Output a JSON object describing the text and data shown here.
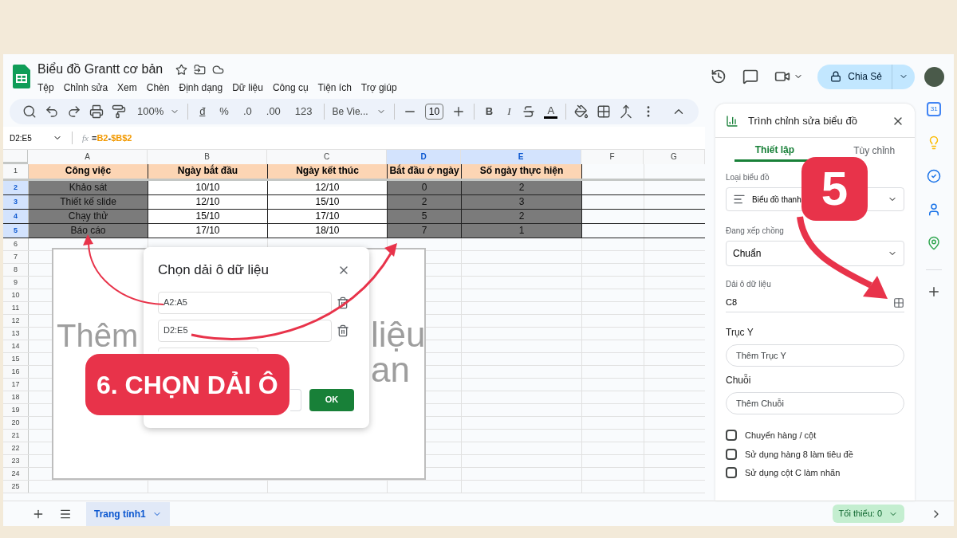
{
  "document": {
    "title": "Biểu đồ Grantt cơ bản"
  },
  "menu": [
    "Tệp",
    "Chỉnh sửa",
    "Xem",
    "Chèn",
    "Định dạng",
    "Dữ liệu",
    "Công cụ",
    "Tiện ích",
    "Trợ giúp"
  ],
  "share_button": {
    "label": "Chia Sẻ"
  },
  "toolbar": {
    "zoom": "100%",
    "currency": "đ",
    "percent": "%",
    "decrease_decimal": ".0",
    "increase_decimal": ".00",
    "number_format": "123",
    "font": "Be Vie...",
    "font_size": "10",
    "bold": "B",
    "italic": "I",
    "text_color": "A"
  },
  "formula_bar": {
    "name_box": "D2:E5",
    "fx": "fx",
    "tokens": [
      {
        "text": "=",
        "kind": "operator"
      },
      {
        "text": "B2",
        "kind": "reference"
      },
      {
        "text": "-",
        "kind": "operator"
      },
      {
        "text": "$B$2",
        "kind": "reference"
      }
    ]
  },
  "columns": [
    {
      "letter": "A",
      "selected": false
    },
    {
      "letter": "B",
      "selected": false
    },
    {
      "letter": "C",
      "selected": false
    },
    {
      "letter": "D",
      "selected": true
    },
    {
      "letter": "E",
      "selected": true
    },
    {
      "letter": "F",
      "selected": false
    },
    {
      "letter": "G",
      "selected": false
    }
  ],
  "rows": [
    {
      "number": "1",
      "selected": false,
      "kind": "header",
      "cells": [
        {
          "text": "Công việc",
          "highlighted": false
        },
        {
          "text": "Ngày bắt đầu",
          "highlighted": false
        },
        {
          "text": "Ngày kết thúc",
          "highlighted": false
        },
        {
          "text": "Bắt đầu ở ngày",
          "highlighted": false
        },
        {
          "text": "Số ngày thực hiện",
          "highlighted": false
        }
      ]
    },
    {
      "number": "2",
      "selected": true,
      "kind": "data",
      "cells": [
        {
          "text": "Khảo sát",
          "highlighted": true
        },
        {
          "text": "10/10",
          "highlighted": false
        },
        {
          "text": "12/10",
          "highlighted": false
        },
        {
          "text": "0",
          "highlighted": true
        },
        {
          "text": "2",
          "highlighted": true
        }
      ]
    },
    {
      "number": "3",
      "selected": true,
      "kind": "data",
      "cells": [
        {
          "text": "Thiết kế slide",
          "highlighted": true
        },
        {
          "text": "12/10",
          "highlighted": false
        },
        {
          "text": "15/10",
          "highlighted": false
        },
        {
          "text": "2",
          "highlighted": true
        },
        {
          "text": "3",
          "highlighted": true
        }
      ]
    },
    {
      "number": "4",
      "selected": true,
      "kind": "data",
      "cells": [
        {
          "text": "Chạy thử",
          "highlighted": true
        },
        {
          "text": "15/10",
          "highlighted": false
        },
        {
          "text": "17/10",
          "highlighted": false
        },
        {
          "text": "5",
          "highlighted": true
        },
        {
          "text": "2",
          "highlighted": true
        }
      ]
    },
    {
      "number": "5",
      "selected": true,
      "kind": "data",
      "cells": [
        {
          "text": "Báo cáo",
          "highlighted": true
        },
        {
          "text": "17/10",
          "highlighted": false
        },
        {
          "text": "18/10",
          "highlighted": false
        },
        {
          "text": "7",
          "highlighted": true
        },
        {
          "text": "1",
          "highlighted": true
        }
      ]
    },
    {
      "number": "6",
      "selected": false,
      "kind": "empty"
    },
    {
      "number": "7",
      "selected": false,
      "kind": "empty"
    },
    {
      "number": "8",
      "selected": false,
      "kind": "empty"
    },
    {
      "number": "9",
      "selected": false,
      "kind": "empty"
    },
    {
      "number": "10",
      "selected": false,
      "kind": "empty"
    },
    {
      "number": "11",
      "selected": false,
      "kind": "empty"
    },
    {
      "number": "12",
      "selected": false,
      "kind": "empty"
    },
    {
      "number": "13",
      "selected": false,
      "kind": "empty"
    },
    {
      "number": "14",
      "selected": false,
      "kind": "empty"
    },
    {
      "number": "15",
      "selected": false,
      "kind": "empty"
    },
    {
      "number": "16",
      "selected": false,
      "kind": "empty"
    },
    {
      "number": "17",
      "selected": false,
      "kind": "empty"
    },
    {
      "number": "18",
      "selected": false,
      "kind": "empty"
    },
    {
      "number": "19",
      "selected": false,
      "kind": "empty"
    },
    {
      "number": "20",
      "selected": false,
      "kind": "empty"
    },
    {
      "number": "21",
      "selected": false,
      "kind": "empty"
    },
    {
      "number": "22",
      "selected": false,
      "kind": "empty"
    },
    {
      "number": "23",
      "selected": false,
      "kind": "empty"
    },
    {
      "number": "24",
      "selected": false,
      "kind": "empty"
    },
    {
      "number": "25",
      "selected": false,
      "kind": "empty"
    }
  ],
  "chart_placeholder": {
    "fragments": [
      "Thêm",
      "liệu",
      "an"
    ]
  },
  "dialog": {
    "title": "Chọn dải ô dữ liệu",
    "ranges": [
      "A2:A5",
      "D2:E5"
    ],
    "ok_button": "OK"
  },
  "chart_editor": {
    "title": "Trình chỉnh sửa biểu đồ",
    "tabs": [
      {
        "label": "Thiết lập",
        "selected": true
      },
      {
        "label": "Tùy chỉnh",
        "selected": false
      }
    ],
    "chart_type": {
      "label": "Loại biểu đồ",
      "value": "Biểu đồ thanh"
    },
    "stacking": {
      "label": "Đang xếp chồng",
      "value": "Chuẩn"
    },
    "data_range": {
      "label": "Dải ô dữ liệu",
      "value": "C8"
    },
    "y_axis": {
      "label": "Trục Y",
      "placeholder": "Thêm Trục Y"
    },
    "series": {
      "label": "Chuỗi",
      "placeholder": "Thêm Chuỗi"
    },
    "options": [
      {
        "label": "Chuyển hàng / cột",
        "checked": false
      },
      {
        "label": "Sử dụng hàng 8 làm tiêu đề",
        "checked": false
      },
      {
        "label": "Sử dụng cột C làm nhãn",
        "checked": false
      }
    ]
  },
  "rail": {
    "calendar_day": "31"
  },
  "sheet_tabs": [
    {
      "label": "Trang tính1",
      "selected": true
    }
  ],
  "summary": "Tối thiểu: 0",
  "annotations": [
    {
      "text": "6. CHỌN DẢI Ô"
    },
    {
      "text": "5"
    }
  ]
}
